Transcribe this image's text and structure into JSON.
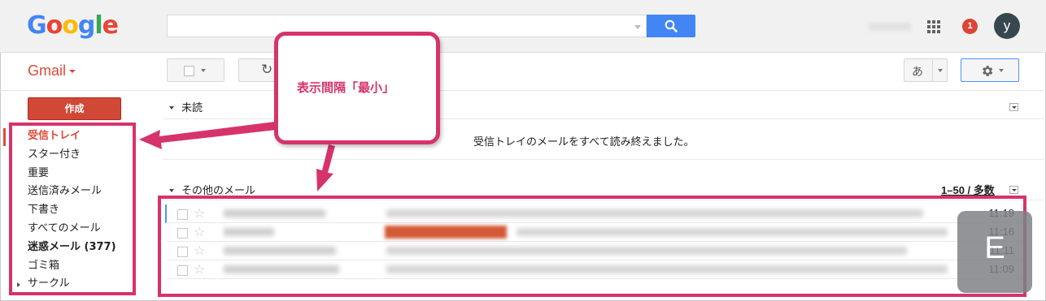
{
  "header": {
    "logo_letters": [
      {
        "char": "G",
        "color": "#4285f4"
      },
      {
        "char": "o",
        "color": "#ea4335"
      },
      {
        "char": "o",
        "color": "#fbbc05"
      },
      {
        "char": "g",
        "color": "#4285f4"
      },
      {
        "char": "l",
        "color": "#34a853"
      },
      {
        "char": "e",
        "color": "#ea4335"
      }
    ],
    "search_value": "",
    "notification_count": "1",
    "avatar_initial": "y"
  },
  "toolbar": {
    "app_label": "Gmail",
    "ime_label": "あ"
  },
  "sidebar": {
    "compose_label": "作成",
    "items": [
      {
        "label": "受信トレイ",
        "style": "active"
      },
      {
        "label": "スター付き",
        "style": ""
      },
      {
        "label": "重要",
        "style": ""
      },
      {
        "label": "送信済みメール",
        "style": ""
      },
      {
        "label": "下書き",
        "style": ""
      },
      {
        "label": "すべてのメール",
        "style": ""
      },
      {
        "label": "迷惑メール (377)",
        "style": "bold"
      },
      {
        "label": "ゴミ箱",
        "style": ""
      },
      {
        "label": "サークル",
        "style": "expandable"
      }
    ]
  },
  "main": {
    "unread_section": "未読",
    "unread_empty_message": "受信トレイのメールをすべて読み終えました。",
    "other_section": "その他のメール",
    "pager": "1–50 / 多数",
    "mails": [
      {
        "time": "11:19"
      },
      {
        "time": "11:16"
      },
      {
        "time": "11:11"
      },
      {
        "time": "11:09"
      }
    ]
  },
  "annotation": {
    "callout_text": "表示間隔「最小」",
    "badge_letter": "E",
    "accent_color": "#d6336c"
  },
  "colors": {
    "compose_red": "#d14836",
    "search_blue": "#4285f4",
    "gmail_red": "#dd4b39"
  }
}
